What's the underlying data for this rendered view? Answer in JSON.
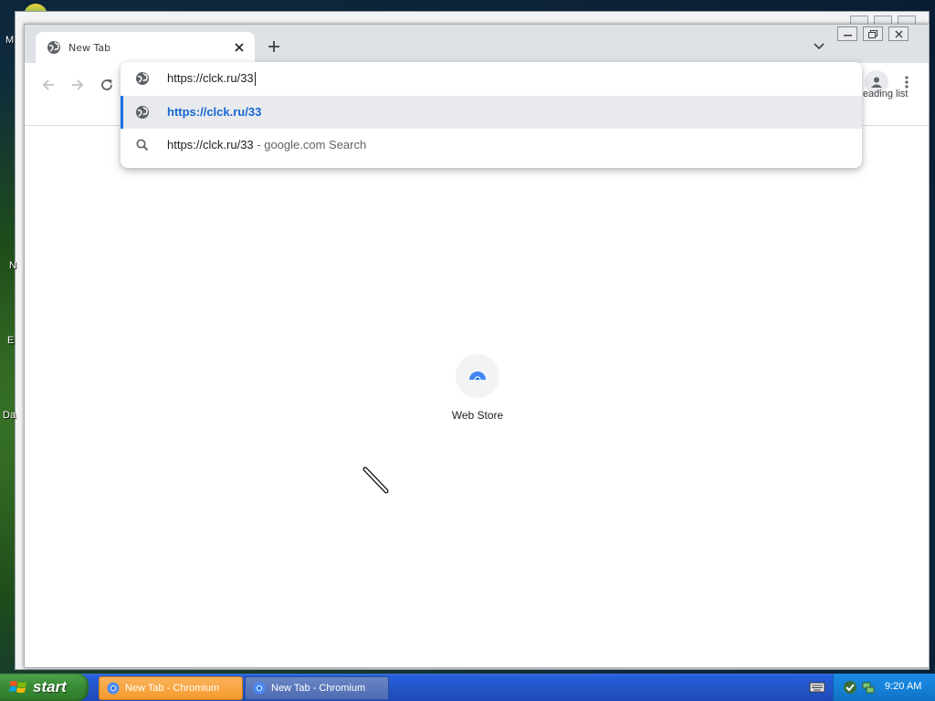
{
  "desktop": {
    "fragments": [
      "M",
      "N",
      "E",
      "Da"
    ]
  },
  "window": {
    "tab": {
      "title": "New Tab"
    },
    "icons": {
      "favicon": "globe-icon",
      "close": "close-icon",
      "new_tab": "plus-icon",
      "tab_search": "chevron-down-icon"
    }
  },
  "toolbar": {
    "back": "arrow-left-icon",
    "forward": "arrow-right-icon",
    "reload": "reload-icon",
    "profile": "person-icon",
    "menu": "kebab-menu-icon",
    "reading_list_label": "Reading list"
  },
  "omnibox": {
    "input_value": "https://clck.ru/33",
    "suggestions": [
      {
        "text": "https://clck.ru/33",
        "suffix": "",
        "icon": "globe-icon",
        "selected": true
      },
      {
        "text": "https://clck.ru/33",
        "suffix": " - google.com Search",
        "icon": "search-icon",
        "selected": false
      }
    ]
  },
  "newtab": {
    "shortcuts": [
      {
        "label": "Web Store",
        "icon": "web-store-icon"
      }
    ]
  },
  "taskbar": {
    "start_label": "start",
    "items": [
      {
        "label": "New Tab - Chromium",
        "active": true
      },
      {
        "label": "New Tab - Chromium",
        "active": false
      }
    ],
    "clock": "9:20 AM"
  },
  "colors": {
    "accent": "#1a73e8",
    "selected_text": "#1967d2",
    "taskbar": "#245edb",
    "start": "#3b8e37"
  }
}
